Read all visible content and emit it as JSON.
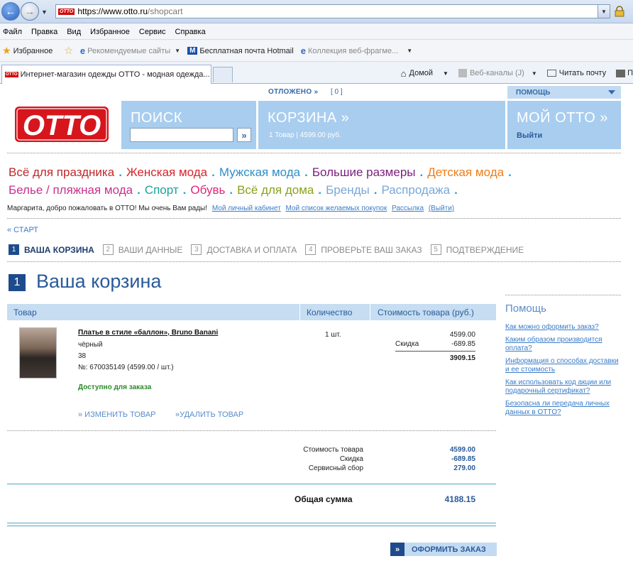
{
  "browser": {
    "url_scheme": "https://www.otto.ru",
    "url_path": "/shopcart",
    "url_logo": "OTTO",
    "menu": [
      "Файл",
      "Правка",
      "Вид",
      "Избранное",
      "Сервис",
      "Справка"
    ],
    "favorites_label": "Избранное",
    "fav_items": [
      "Рекомендуемые сайты",
      "Бесплатная почта Hotmail",
      "Коллекция веб-фрагме..."
    ],
    "tab_title": "Интернет-магазин одежды OTTO - модная одежда...",
    "cmd": [
      "Домой",
      "Веб-каналы (J)",
      "Читать почту",
      "П"
    ]
  },
  "header": {
    "otlojeno": "ОТЛОЖЕНО »",
    "otlojeno_count": "[ 0 ]",
    "help": "ПОМОЩЬ",
    "logo": "OTTO",
    "search_title": "ПОИСК",
    "search_go": "»",
    "cart_title": "КОРЗИНА »",
    "cart_sub": "1 Товар | 4599.00 руб.",
    "myotto_title": "МОЙ OTTO »",
    "logout": "Выйти"
  },
  "categories": [
    {
      "label": "Всё для праздника",
      "color": "#c0282b"
    },
    {
      "label": "Женская мода",
      "color": "#d8232a"
    },
    {
      "label": "Мужская мода",
      "color": "#2d8fc8"
    },
    {
      "label": "Большие размеры",
      "color": "#7a1e7e"
    },
    {
      "label": "Детская мода",
      "color": "#ee7d1a"
    },
    {
      "label": "Белье / пляжная мода",
      "color": "#c8328c"
    },
    {
      "label": "Спорт",
      "color": "#19a59a"
    },
    {
      "label": "Обувь",
      "color": "#e0287a"
    },
    {
      "label": "Всё для дома",
      "color": "#8aa21a"
    },
    {
      "label": "Бренды",
      "color": "#79a7d8"
    },
    {
      "label": "Распродажа",
      "color": "#79a7d8"
    }
  ],
  "welcome": {
    "text": "Маргарита, добро пожаловать в OTTO! Мы очень Вам рады!",
    "links": [
      "Мой личный кабинет",
      "Мой список желаемых покупок",
      "Рассылка",
      "(Выйти)"
    ]
  },
  "start": "« СТАРТ",
  "steps": [
    {
      "num": "1",
      "label": "ВАША КОРЗИНА",
      "active": true
    },
    {
      "num": "2",
      "label": "ВАШИ ДАННЫЕ",
      "active": false
    },
    {
      "num": "3",
      "label": "ДОСТАВКА И ОПЛАТА",
      "active": false
    },
    {
      "num": "4",
      "label": "ПРОВЕРЬТЕ ВАШ ЗАКАЗ",
      "active": false
    },
    {
      "num": "5",
      "label": "ПОДТВЕРЖДЕНИЕ",
      "active": false
    }
  ],
  "heading": {
    "num": "1",
    "title": "Ваша корзина"
  },
  "table": {
    "col_item": "Товар",
    "col_qty": "Количество",
    "col_cost": "Стоимость товара (руб.)"
  },
  "product": {
    "name": "Платье в стиле «баллон», Bruno Banani",
    "color": "чёрный",
    "size": "38",
    "number": "№: 670035149 (4599.00 / шт.)",
    "availability": "Доступно для заказа",
    "qty": "1  шт.",
    "price": "4599.00",
    "discount_label": "Скидка",
    "discount": "-689.85",
    "subtotal": "3909.15",
    "edit": "» ИЗМЕНИТЬ ТОВАР",
    "delete": "»УДАЛИТЬ ТОВАР"
  },
  "summary": {
    "cost_label": "Стоимость товара",
    "cost": "4599.00",
    "discount_label": "Скидка",
    "discount": "-689.85",
    "service_label": "Сервисный сбор",
    "service": "279.00",
    "total_label": "Общая сумма",
    "total": "4188.15"
  },
  "order_button": {
    "arrow": "»",
    "label": "ОФОРМИТЬ ЗАКАЗ"
  },
  "help_side": {
    "title": "Помощь",
    "links": [
      "Как можно оформить заказ?",
      "Каким образом производится оплата?",
      "Информация о способах доставки и ее стоимость",
      "Как использовать код акции или подарочный сертификат?",
      "Безопасна ли передача личных данных в OTTO?"
    ]
  }
}
